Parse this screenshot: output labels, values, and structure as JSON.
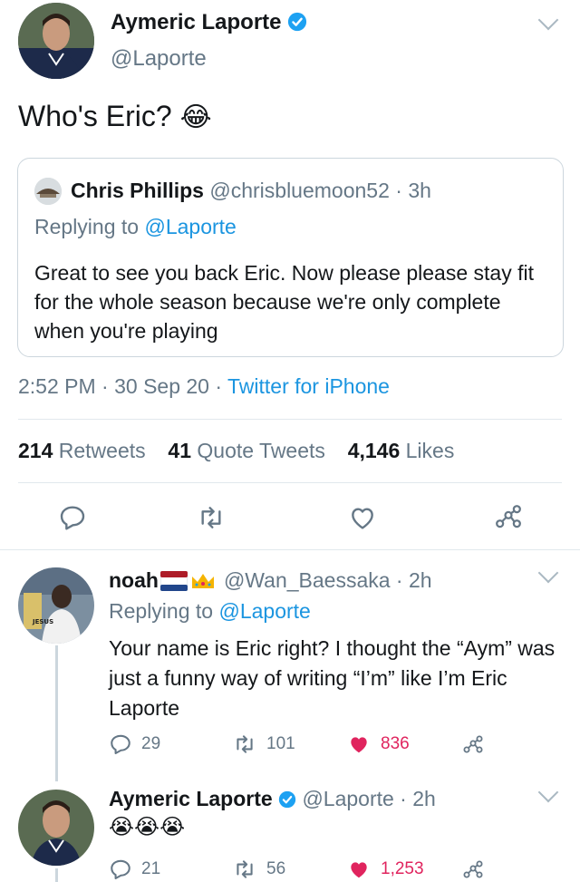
{
  "main_tweet": {
    "author_name": "Aymeric Laporte",
    "handle": "@Laporte",
    "text": "Who's Eric?",
    "emoji": "😂",
    "quoted": {
      "author_name": "Chris Phillips",
      "handle_time": "@chrisbluemoon52 · 3h",
      "replying_prefix": "Replying to",
      "replying_handle": "@Laporte",
      "text": "Great to see you back Eric. Now please please stay fit for the whole season because we're only complete when you're playing"
    },
    "timestamp": "2:52 PM · 30 Sep 20 ·",
    "source": "Twitter for iPhone",
    "stats": {
      "retweets_count": "214",
      "retweets_label": "Retweets",
      "quotes_count": "41",
      "quotes_label": "Quote Tweets",
      "likes_count": "4,146",
      "likes_label": "Likes"
    }
  },
  "reply1": {
    "author_name": "noah",
    "handle_time": "@Wan_Baessaka · 2h",
    "replying_prefix": "Replying to",
    "replying_handle": "@Laporte",
    "text": "Your name is Eric right? I thought the “Aym” was just a funny way of writing “I’m” like I’m Eric Laporte",
    "replies": "29",
    "retweets": "101",
    "likes": "836",
    "avatar_caption": "ZABALI\nu\nJESUS"
  },
  "reply2": {
    "author_name": "Aymeric Laporte",
    "handle_time": "@Laporte · 2h",
    "text": "😭😭😭",
    "replies": "21",
    "retweets": "56",
    "likes": "1,253"
  },
  "colors": {
    "link": "#1b95e0",
    "muted": "#657786",
    "like": "#e0245e",
    "verified": "#1da1f2"
  }
}
